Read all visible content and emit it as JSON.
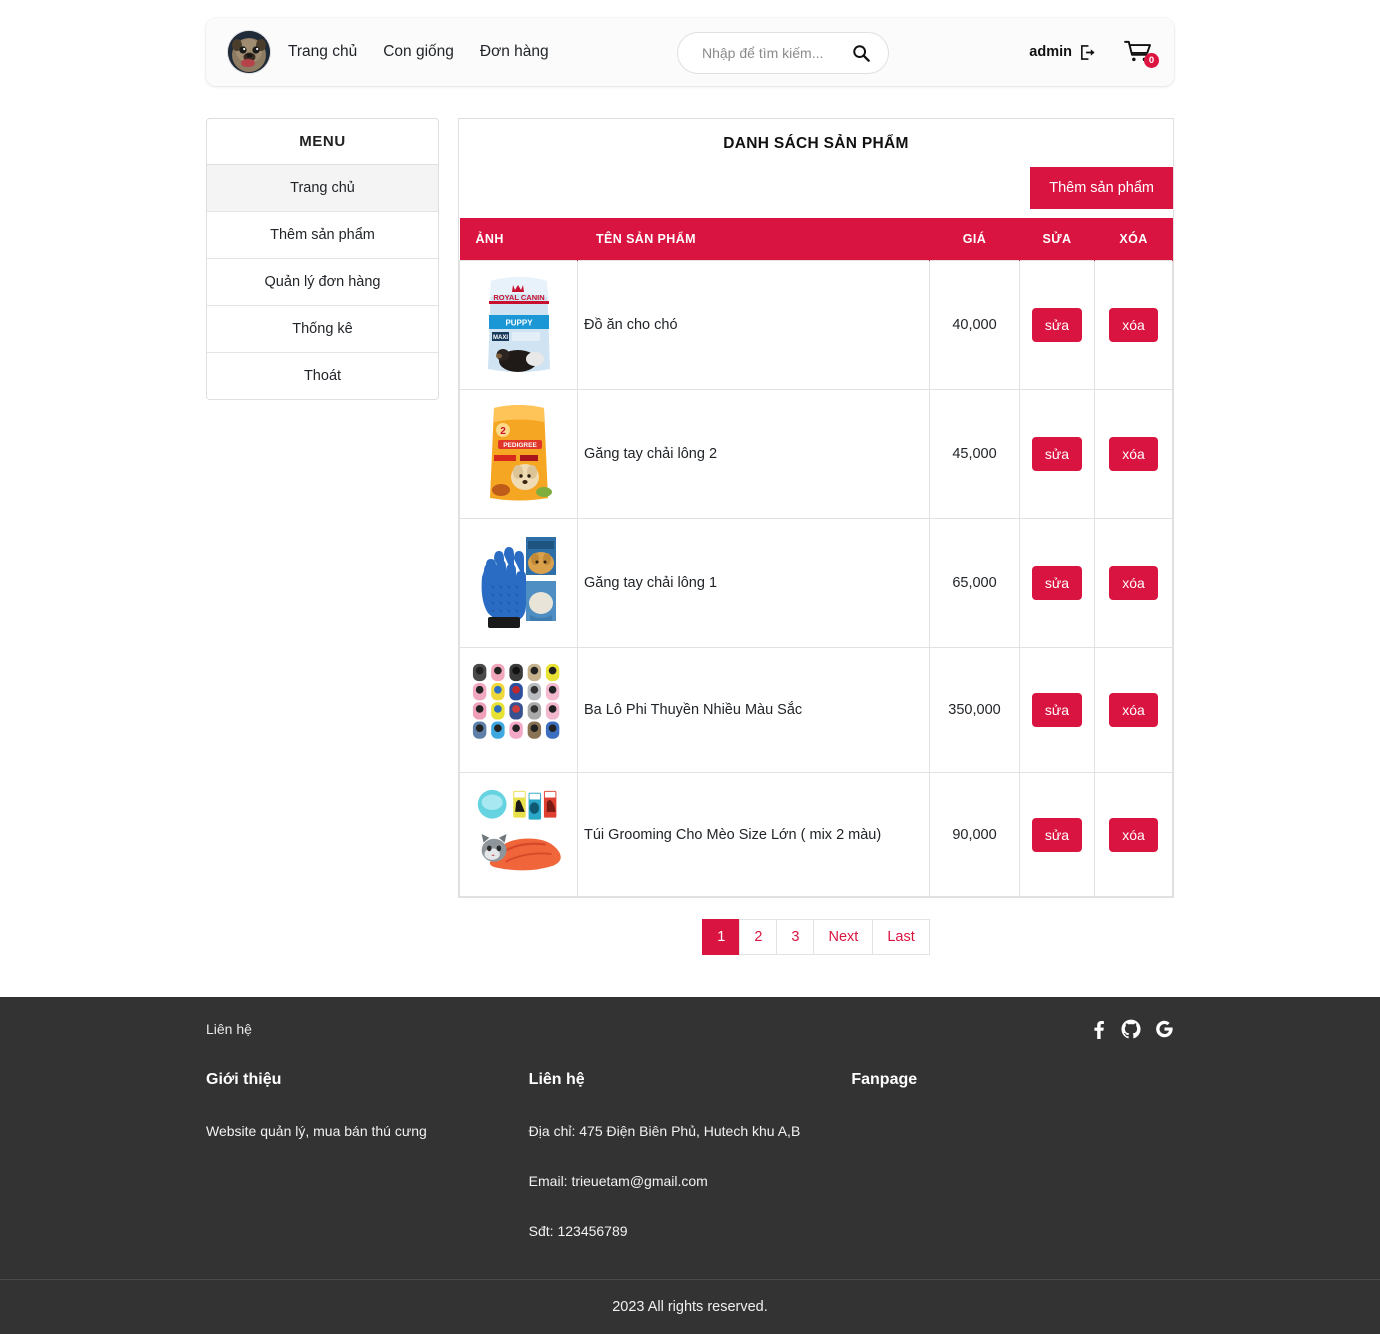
{
  "header": {
    "avatar_alt": "pug-dog-avatar",
    "nav": [
      {
        "label": "Trang chủ"
      },
      {
        "label": "Con giống"
      },
      {
        "label": "Đơn hàng"
      }
    ],
    "search": {
      "placeholder": "Nhập để tìm kiếm...",
      "value": "",
      "icon": "search-icon"
    },
    "account": {
      "name": "admin",
      "logout_icon": "logout-icon"
    },
    "cart": {
      "icon": "cart-icon",
      "count": "0"
    }
  },
  "sidebar": {
    "title": "MENU",
    "items": [
      {
        "label": "Trang chủ",
        "active": true
      },
      {
        "label": "Thêm sản phẩm",
        "active": false
      },
      {
        "label": "Quản lý đơn hàng",
        "active": false
      },
      {
        "label": "Thống kê",
        "active": false
      },
      {
        "label": "Thoát",
        "active": false
      }
    ]
  },
  "main": {
    "title": "DANH SÁCH SẢN PHẨM",
    "add_button": "Thêm sản phẩm",
    "table": {
      "headers": {
        "image": "ẢNH",
        "name": "TÊN SẢN PHẨM",
        "price": "GIÁ",
        "edit": "SỬA",
        "delete": "XÓA"
      },
      "edit_label": "sửa",
      "delete_label": "xóa",
      "rows": [
        {
          "image": "royal-canin-puppy-food-bag",
          "name": "Đồ ăn cho chó",
          "price": "40,000"
        },
        {
          "image": "pedigree-dog-food-bag",
          "name": "Găng tay chải lông 2",
          "price": "45,000"
        },
        {
          "image": "blue-pet-grooming-glove",
          "name": "Găng tay chải lông 1",
          "price": "65,000"
        },
        {
          "image": "colorful-pet-backpacks-grid",
          "name": "Ba Lô Phi Thuyền Nhiều Màu Sắc",
          "price": "350,000"
        },
        {
          "image": "cat-grooming-bag-orange",
          "name": "Túi Grooming Cho Mèo Size Lớn ( mix 2 màu)",
          "price": "90,000"
        }
      ]
    },
    "pagination": [
      {
        "label": "1",
        "active": true
      },
      {
        "label": "2",
        "active": false
      },
      {
        "label": "3",
        "active": false
      },
      {
        "label": "Next",
        "active": false
      },
      {
        "label": "Last",
        "active": false
      }
    ]
  },
  "footer": {
    "top_link": "Liên hệ",
    "socials": [
      {
        "name": "facebook-icon"
      },
      {
        "name": "github-icon"
      },
      {
        "name": "google-icon"
      }
    ],
    "columns": [
      {
        "heading": "Giới thiệu",
        "lines": [
          "Website quản lý, mua bán thú cưng"
        ]
      },
      {
        "heading": "Liên hệ",
        "lines": [
          "Địa chỉ: 475 Điện Biên Phủ, Hutech khu A,B",
          "Email: trieuetam@gmail.com",
          "Sđt: 123456789"
        ]
      },
      {
        "heading": "Fanpage",
        "lines": []
      }
    ],
    "copyright": "2023 All rights reserved."
  },
  "colors": {
    "accent": "#d91440",
    "footer_bg": "#333333",
    "page_bg": "#ffffff"
  }
}
